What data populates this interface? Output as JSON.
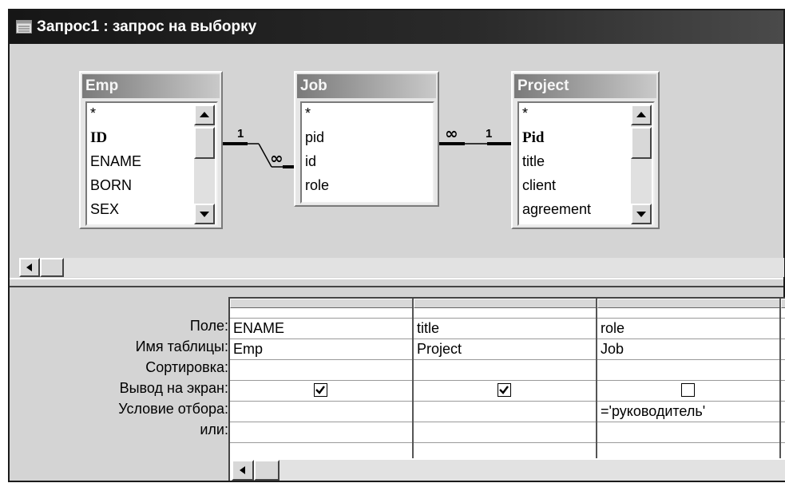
{
  "window": {
    "title": "Запрос1 : запрос на выборку"
  },
  "tables": [
    {
      "name": "Emp",
      "fields": [
        "*",
        "ID",
        "ENAME",
        "BORN",
        "SEX"
      ],
      "key_field": "ID"
    },
    {
      "name": "Job",
      "fields": [
        "*",
        "pid",
        "id",
        "role"
      ]
    },
    {
      "name": "Project",
      "fields": [
        "*",
        "Pid",
        "title",
        "client",
        "agreement"
      ],
      "key_field": "Pid"
    }
  ],
  "relationships": [
    {
      "from": "Emp",
      "to": "Job",
      "from_label": "1",
      "to_label": "∞"
    },
    {
      "from": "Job",
      "to": "Project",
      "from_label": "∞",
      "to_label": "1"
    }
  ],
  "grid": {
    "row_labels": [
      "Поле:",
      "Имя таблицы:",
      "Сортировка:",
      "Вывод на экран:",
      "Условие отбора:",
      "или:"
    ],
    "columns": [
      {
        "field": "ENAME",
        "table": "Emp",
        "sort": "",
        "show": true,
        "criteria": "",
        "or": ""
      },
      {
        "field": "title",
        "table": "Project",
        "sort": "",
        "show": true,
        "criteria": "",
        "or": ""
      },
      {
        "field": "role",
        "table": "Job",
        "sort": "",
        "show": false,
        "criteria": "='руководитель'",
        "or": ""
      }
    ]
  },
  "colors": {
    "titlebar": "#1a1a1a",
    "pane_bg": "#d4d4d4",
    "table_title": "#9a9a9a"
  },
  "icons": [
    "query-window-icon",
    "scroll-up-arrow-icon",
    "scroll-down-arrow-icon",
    "scroll-left-arrow-icon",
    "checkbox-checked-icon",
    "checkbox-unchecked-icon"
  ]
}
